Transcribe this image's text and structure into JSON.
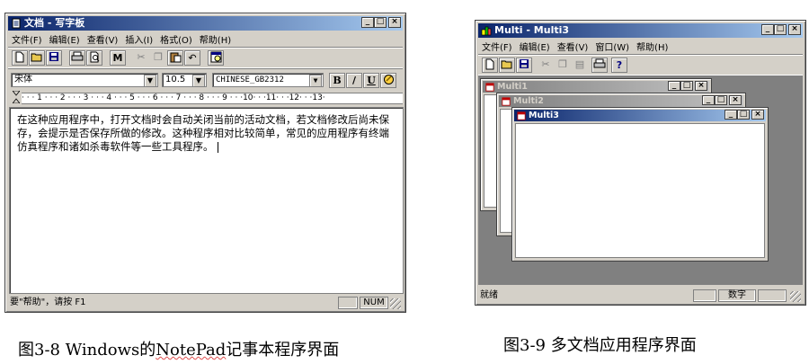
{
  "notepad": {
    "title": "文档 - 写字板",
    "menu": [
      "文件(F)",
      "编辑(E)",
      "查看(V)",
      "插入(I)",
      "格式(O)",
      "帮助(H)"
    ],
    "toolbar_icons": [
      "new-icon",
      "open-icon",
      "save-icon",
      "print-icon",
      "print-preview-icon",
      "find-icon",
      "cut-icon",
      "copy-icon",
      "paste-icon",
      "undo-icon",
      "insert-datetime-icon"
    ],
    "font_name": "宋体",
    "font_size": "10.5",
    "script": "CHINESE_GB2312",
    "format_buttons": {
      "bold": "B",
      "italic": "/",
      "underline": "U"
    },
    "ruler": "· · · 1 · · · 2 · · · 3 · · · 4 · · · 5 · · · 6 · · · 7 · · · 8 · · · 9 · · ·10· · ·11· · ·12· · ·13·",
    "body_text": "在这种应用程序中，打开文档时会自动关闭当前的活动文档，若文档修改后尚未保存，会提示是否保存所做的修改。这种程序相对比较简单，常见的应用程序有终端仿真程序和诸如杀毒软件等一些工具程序。",
    "status_text": "要\"帮助\"，请按 F1",
    "status_num": "NUM"
  },
  "multi": {
    "title": "Multi - Multi3",
    "menu": [
      "文件(F)",
      "编辑(E)",
      "查看(V)",
      "窗口(W)",
      "帮助(H)"
    ],
    "toolbar_icons": [
      "new-icon",
      "open-icon",
      "save-icon",
      "cut-icon",
      "copy-icon",
      "paste-icon",
      "print-icon",
      "about-icon"
    ],
    "children": [
      "Multi1",
      "Multi2",
      "Multi3"
    ],
    "status_text": "就绪",
    "status_num": "数字"
  },
  "captions": {
    "left_prefix": "图3-8 Windows的",
    "left_underlined": "NotePad",
    "left_suffix": "记事本程序界面",
    "right": "图3-9 多文档应用程序界面"
  }
}
